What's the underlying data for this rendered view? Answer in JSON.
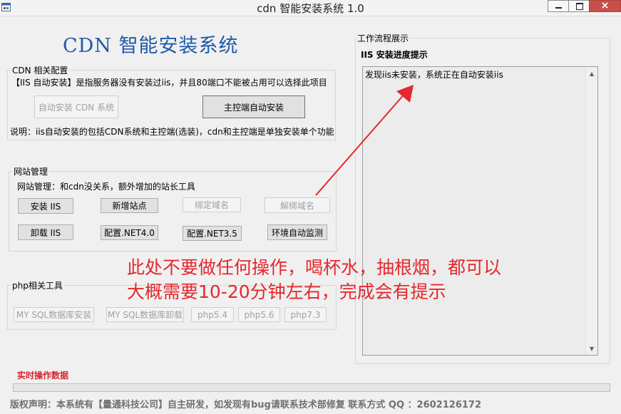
{
  "window": {
    "title": "cdn 智能安装系统 1.0",
    "controls": {
      "minimize": "minimize",
      "maximize": "maximize",
      "close": "×"
    }
  },
  "heading": "CDN 智能安装系统",
  "cdn_group": {
    "legend": "CDN 相关配置",
    "hint": "【IIS 自动安装】是指服务器没有安装过iis，并且80端口不能被占用可以选择此项目",
    "buttons": {
      "auto_install_cdn": "自动安装 CDN 系统",
      "master_auto_install": "主控端自动安装"
    },
    "note": "说明：iis自动安装的包括CDN系统和主控端(选装)，cdn和主控端是单独安装单个功能"
  },
  "site_group": {
    "legend": "网站管理",
    "hint": "网站管理：和cdn没关系，额外增加的站长工具",
    "buttons": {
      "install_iis": "安装 IIS",
      "add_site": "新增站点",
      "bind_domain": "绑定域名",
      "unbind_domain": "解绑域名",
      "uninstall_iis": "卸载 IIS",
      "config_net40": "配置.NET4.0",
      "config_net35": "配置.NET3.5",
      "env_check": "环境自动监测"
    }
  },
  "php_group": {
    "legend": "php相关工具",
    "buttons": {
      "mysql_install": "MY SQL数据库安装",
      "mysql_uninstall": "MY SQL数据库卸载",
      "php54": "php5.4",
      "php56": "php5.6",
      "php73": "php7.3"
    }
  },
  "workflow": {
    "legend": "工作流程展示",
    "progress_title": "IIS 安装进度提示",
    "log_text": "发现iis未安装，系统正在自动安装iis"
  },
  "overlay_note": {
    "line1": "此处不要做任何操作，喝杯水，抽根烟，都可以",
    "line2": "大概需要10-20分钟左右，完成会有提示"
  },
  "status": {
    "label": "实时操作数据",
    "progress_fraction": 0
  },
  "copyright": "版权声明：本系统有【量通科技公司】自主研发，如发现有bug请联系技术部修复 联系方式 QQ ：2602126172",
  "colors": {
    "heading": "#1e5aa8",
    "annotation_red": "#e4282d",
    "status_red": "#d4242a",
    "window_close": "#c7504b",
    "log_background": "#ececec"
  }
}
